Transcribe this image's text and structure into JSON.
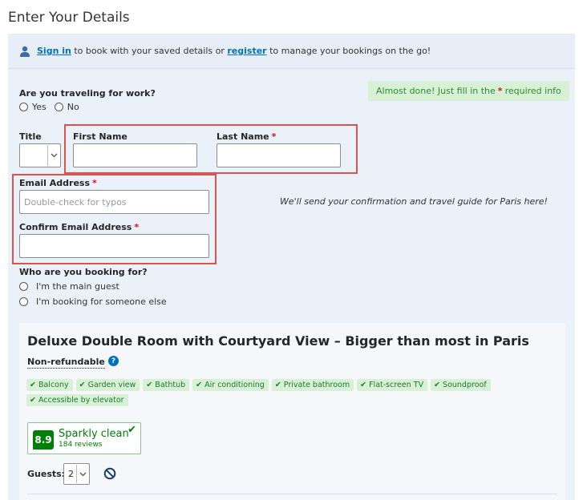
{
  "page": {
    "title": "Enter Your Details"
  },
  "signin": {
    "signin_link": "Sign in",
    "text1": " to book with your saved details or ",
    "register_link": "register",
    "text2": " to manage your bookings on the go!"
  },
  "notice": {
    "before": "Almost done! Just fill in the",
    "star": "*",
    "after": "required info"
  },
  "work_travel": {
    "question": "Are you traveling for work?",
    "options": [
      "Yes",
      "No"
    ]
  },
  "fields": {
    "title_label": "Title",
    "first_name_label": "First Name",
    "last_name_label": "Last Name",
    "required_star": "*",
    "email_label": "Email Address",
    "email_placeholder": "Double-check for typos",
    "confirm_email_label": "Confirm Email Address"
  },
  "email_note": "We'll send your confirmation and travel guide for Paris here!",
  "booking_for": {
    "question": "Who are you booking for?",
    "options": [
      "I'm the main guest",
      "I'm booking for someone else"
    ]
  },
  "room": {
    "title": "Deluxe Double Room with Courtyard View – Bigger than most in Paris",
    "policy": "Non-refundable",
    "help_icon_glyph": "?",
    "check_glyph": "✔",
    "amenities": [
      "Balcony",
      "Garden view",
      "Bathtub",
      "Air conditioning",
      "Private bathroom",
      "Flat-screen TV",
      "Soundproof",
      "Accessible by elevator"
    ],
    "review": {
      "score": "8.9",
      "word": "Sparkly clean",
      "count": "184 reviews",
      "check_glyph": "✔"
    },
    "guests_label": "Guests:",
    "guests_value": "2"
  },
  "colors": {
    "accent": "#0071c2",
    "required": "#d4111e",
    "success": "#008009",
    "highlight": "#d9534f"
  },
  "icons": [
    "user-icon",
    "chevron-down-icon",
    "question-icon",
    "check-icon",
    "no-smoking-icon"
  ]
}
